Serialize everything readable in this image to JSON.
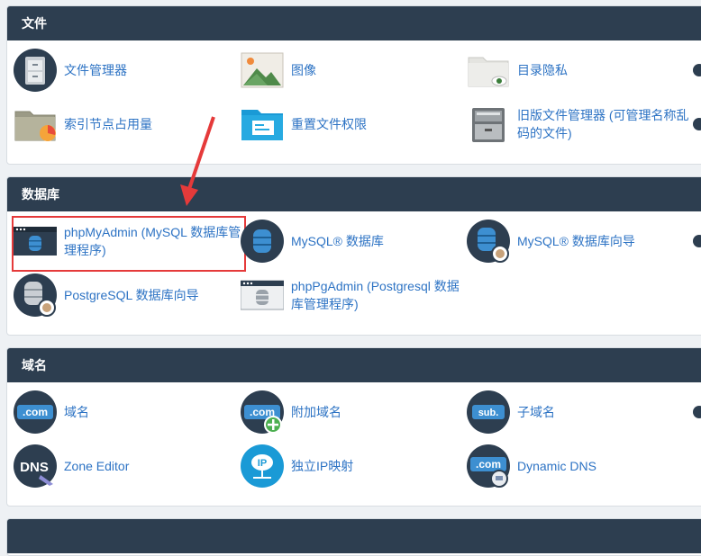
{
  "sections": {
    "files": {
      "title": "文件",
      "items": [
        {
          "label": "文件管理器",
          "icon": "file-cabinet-icon"
        },
        {
          "label": "图像",
          "icon": "image-icon"
        },
        {
          "label": "目录隐私",
          "icon": "folder-privacy-icon"
        },
        {
          "label": "索引节点占用量",
          "icon": "disk-usage-icon"
        },
        {
          "label": "重置文件权限",
          "icon": "file-permissions-icon"
        },
        {
          "label": "旧版文件管理器 (可管理名称乱码的文件)",
          "icon": "legacy-file-manager-icon"
        }
      ]
    },
    "databases": {
      "title": "数据库",
      "items": [
        {
          "label": "phpMyAdmin (MySQL 数据库管理程序)",
          "icon": "phpmyadmin-icon"
        },
        {
          "label": "MySQL® 数据库",
          "icon": "mysql-database-icon"
        },
        {
          "label": "MySQL® 数据库向导",
          "icon": "mysql-wizard-icon"
        },
        {
          "label": "PostgreSQL 数据库向导",
          "icon": "postgresql-wizard-icon"
        },
        {
          "label": "phpPgAdmin (Postgresql 数据库管理程序)",
          "icon": "phppgadmin-icon"
        }
      ]
    },
    "domains": {
      "title": "域名",
      "items": [
        {
          "label": "域名",
          "icon": "com-domain-icon",
          "badge": ".com"
        },
        {
          "label": "附加域名",
          "icon": "addon-domain-icon",
          "badge": ".com"
        },
        {
          "label": "子域名",
          "icon": "subdomain-icon",
          "badge": "sub."
        },
        {
          "label": "Zone Editor",
          "icon": "dns-zone-icon",
          "badge": "DNS"
        },
        {
          "label": "独立IP映射",
          "icon": "ip-icon",
          "badge": "IP"
        },
        {
          "label": "Dynamic DNS",
          "icon": "dynamic-dns-icon",
          "badge": ".com"
        }
      ]
    }
  },
  "colors": {
    "header_bg": "#2d3e50",
    "link": "#2d73c4",
    "highlight": "#e53a3a"
  }
}
